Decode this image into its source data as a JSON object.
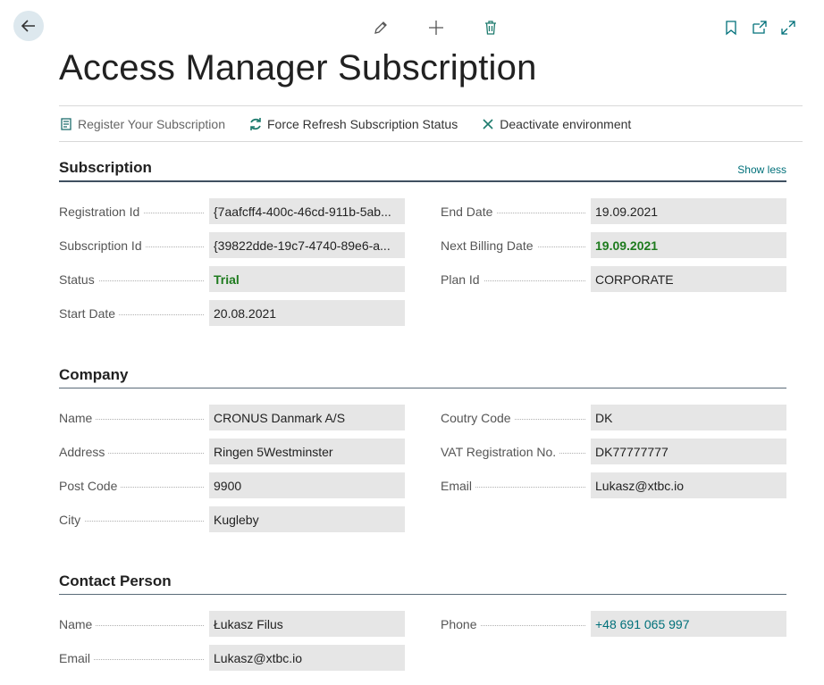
{
  "page": {
    "title": "Access Manager Subscription"
  },
  "actions": {
    "register": "Register Your Subscription",
    "refresh": "Force Refresh Subscription Status",
    "deactivate": "Deactivate environment"
  },
  "subscription": {
    "title": "Subscription",
    "show_less": "Show less",
    "registration_id": {
      "label": "Registration Id",
      "value": "{7aafcff4-400c-46cd-911b-5ab..."
    },
    "subscription_id": {
      "label": "Subscription Id",
      "value": "{39822dde-19c7-4740-89e6-a..."
    },
    "status": {
      "label": "Status",
      "value": "Trial"
    },
    "start_date": {
      "label": "Start Date",
      "value": "20.08.2021"
    },
    "end_date": {
      "label": "End Date",
      "value": "19.09.2021"
    },
    "next_billing_date": {
      "label": "Next Billing Date",
      "value": "19.09.2021"
    },
    "plan_id": {
      "label": "Plan Id",
      "value": "CORPORATE"
    }
  },
  "company": {
    "title": "Company",
    "name": {
      "label": "Name",
      "value": "CRONUS Danmark A/S"
    },
    "address": {
      "label": "Address",
      "value": "Ringen 5Westminster"
    },
    "post_code": {
      "label": "Post Code",
      "value": "9900"
    },
    "city": {
      "label": "City",
      "value": "Kugleby"
    },
    "country_code": {
      "label": "Coutry Code",
      "value": "DK"
    },
    "vat": {
      "label": "VAT Registration No.",
      "value": "DK77777777"
    },
    "email": {
      "label": "Email",
      "value": "Lukasz@xtbc.io"
    }
  },
  "contact": {
    "title": "Contact Person",
    "name": {
      "label": "Name",
      "value": "Łukasz Filus"
    },
    "email": {
      "label": "Email",
      "value": "Lukasz@xtbc.io"
    },
    "phone": {
      "label": "Phone",
      "value": "+48 691 065 997"
    }
  },
  "icons": {
    "back": "arrow-left-icon",
    "edit": "pencil-icon",
    "new": "plus-icon",
    "delete": "trash-icon",
    "bookmark": "bookmark-icon",
    "open_new": "open-in-new-window-icon",
    "expand": "expand-icon"
  },
  "colors": {
    "accent": "#00707a",
    "positive": "#1e7b1e",
    "field_bg": "#e6e6e6"
  }
}
